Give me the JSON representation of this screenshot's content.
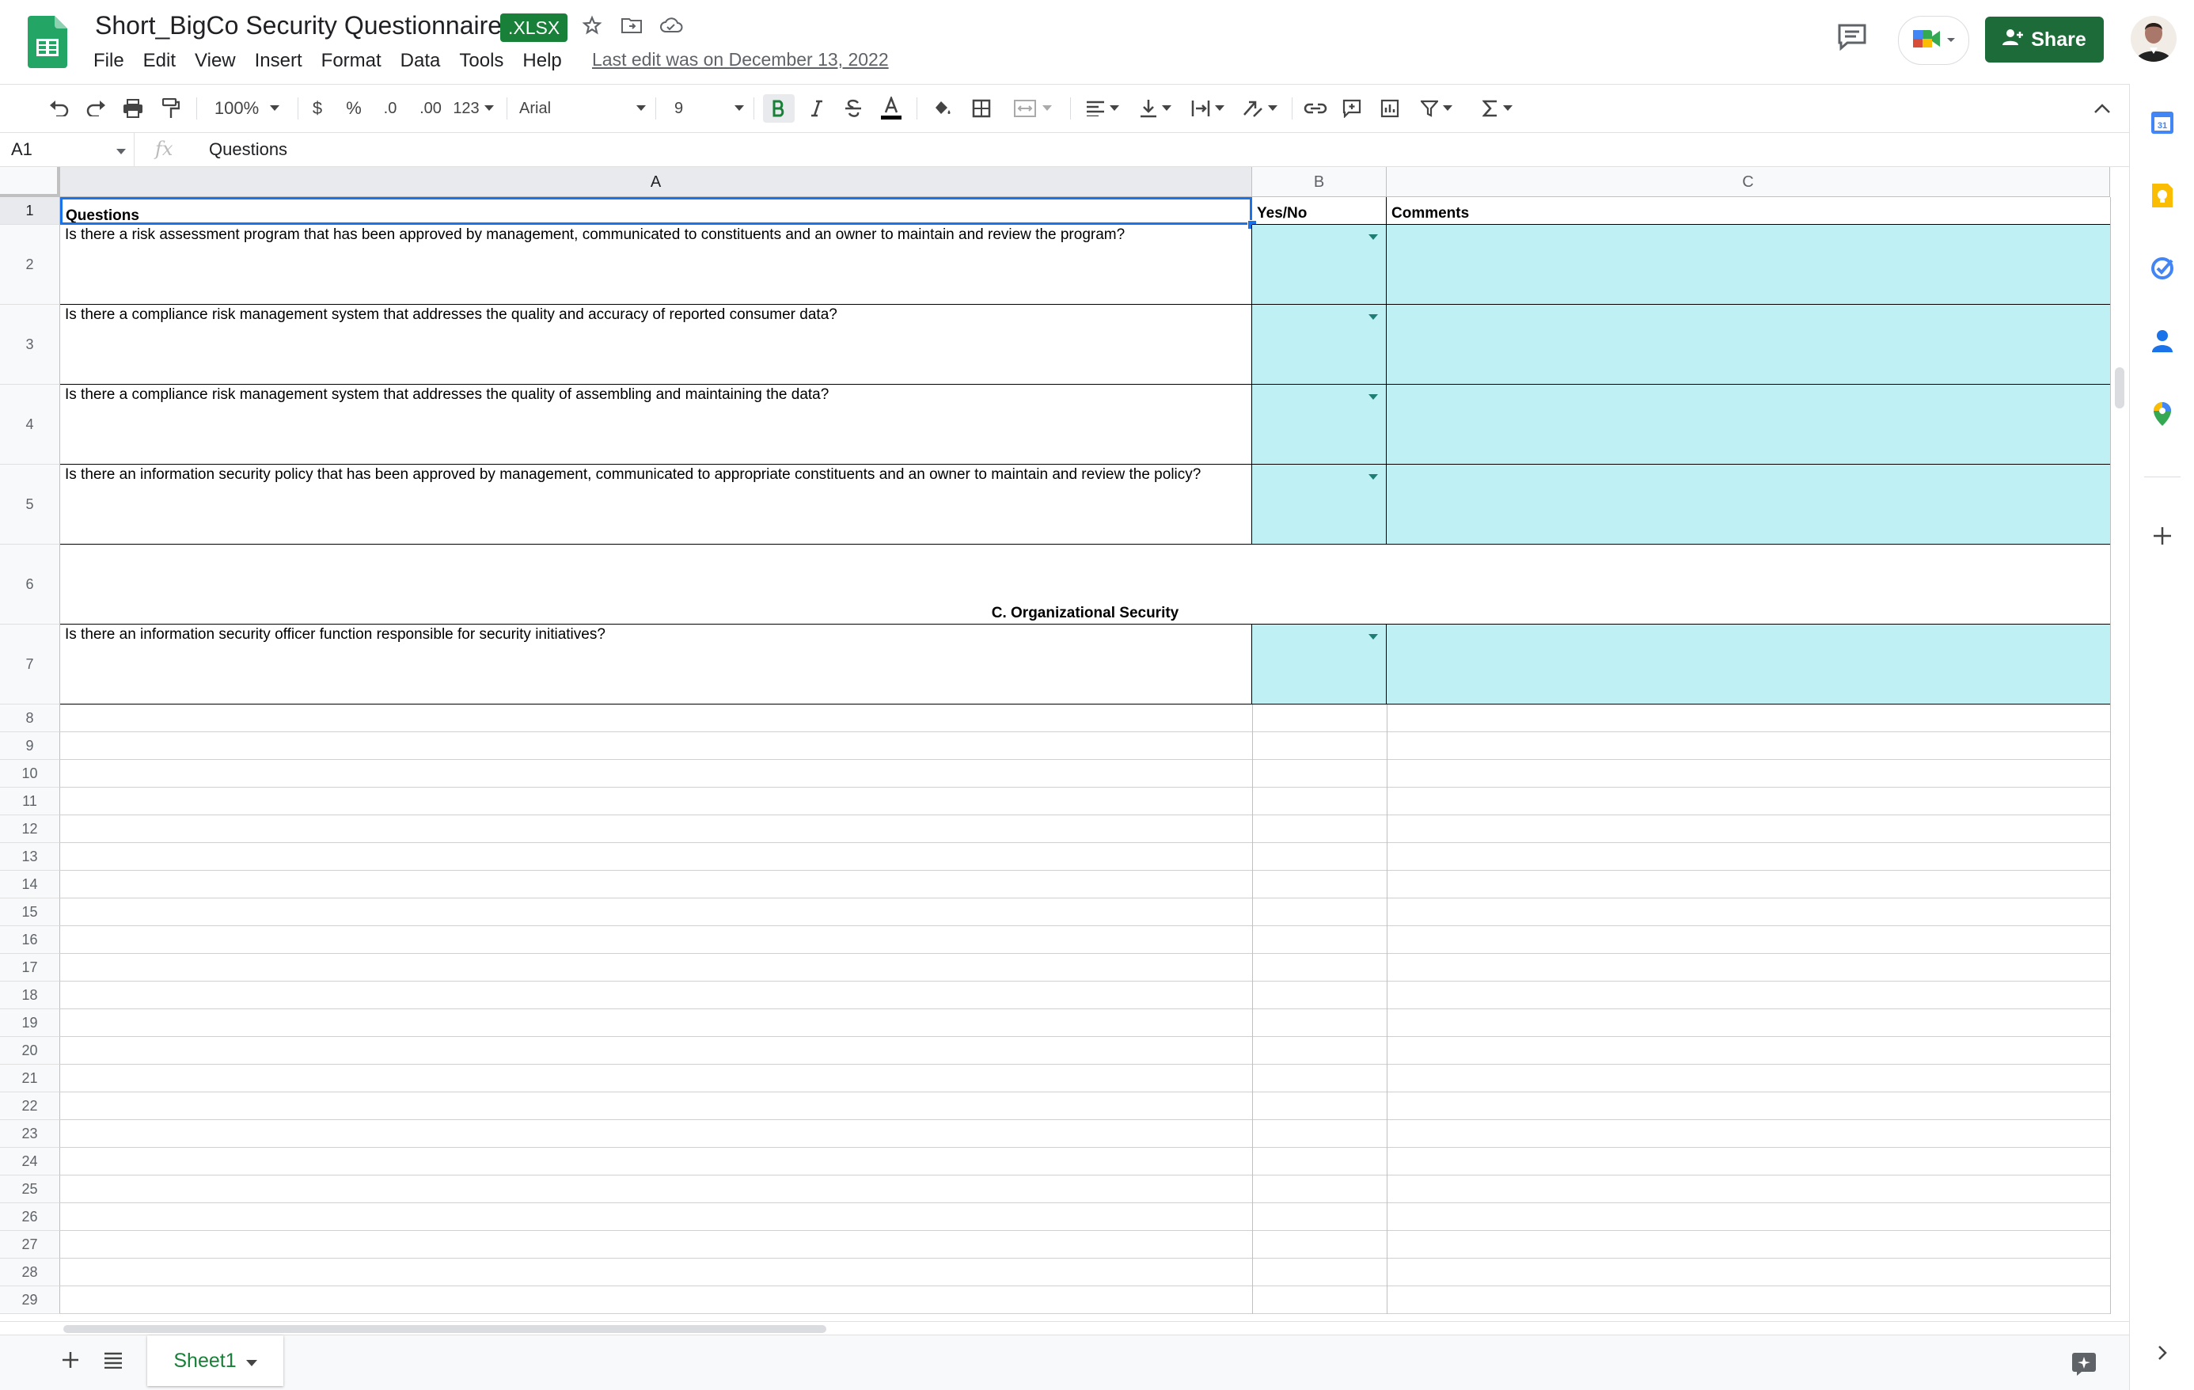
{
  "header": {
    "title": "Short_BigCo Security Questionnaire",
    "badge": ".XLSX",
    "last_edit": "Last edit was on December 13, 2022",
    "share_label": "Share"
  },
  "menu": [
    "File",
    "Edit",
    "View",
    "Insert",
    "Format",
    "Data",
    "Tools",
    "Help"
  ],
  "toolbar": {
    "zoom": "100%",
    "currency": "$",
    "percent": "%",
    "decrease_decimal": ".0",
    "increase_decimal": ".00",
    "more_formats": "123",
    "font": "Arial",
    "font_size": "9"
  },
  "formula_bar": {
    "cell_ref": "A1",
    "fx": "fx",
    "content": "Questions"
  },
  "columns": [
    "A",
    "B",
    "C"
  ],
  "rows": {
    "header": {
      "num": "1",
      "a": "Questions",
      "b": "Yes/No",
      "c": "Comments"
    },
    "questions": [
      {
        "num": "2",
        "text": "Is there a risk assessment program that has been approved by management, communicated to constituents and an owner to maintain and review the program?"
      },
      {
        "num": "3",
        "text": "Is there a compliance risk management system that addresses the quality and accuracy of reported consumer data?"
      },
      {
        "num": "4",
        "text": "Is there a compliance risk management system that addresses the quality of assembling and maintaining the data?"
      },
      {
        "num": "5",
        "text": "Is there an information security policy that has been approved by management, communicated to appropriate constituents and an owner to maintain and review the policy?"
      }
    ],
    "section": {
      "num": "6",
      "text": "C. Organizational Security"
    },
    "question7": {
      "num": "7",
      "text": "Is there an information security officer function responsible for security initiatives?"
    },
    "empty_rows": [
      "8",
      "9",
      "10",
      "11",
      "12",
      "13",
      "14",
      "15",
      "16",
      "17",
      "18",
      "19",
      "20",
      "21",
      "22",
      "23",
      "24",
      "25",
      "26",
      "27",
      "28",
      "29"
    ]
  },
  "sheets": {
    "active": "Sheet1"
  },
  "colors": {
    "brand_green": "#188038",
    "share_bg": "#1e6b3a",
    "input_cell": "#bff1f4",
    "dropdown_arrow": "#1e7d74"
  },
  "icons": {
    "header": [
      "sheets-logo-icon",
      "star-icon",
      "move-folder-icon",
      "cloud-status-icon",
      "comment-history-icon",
      "meet-icon",
      "share-person-icon"
    ],
    "side": [
      "calendar-icon",
      "keep-icon",
      "tasks-icon",
      "contacts-icon",
      "maps-icon",
      "add-icon",
      "expand-icon"
    ]
  }
}
